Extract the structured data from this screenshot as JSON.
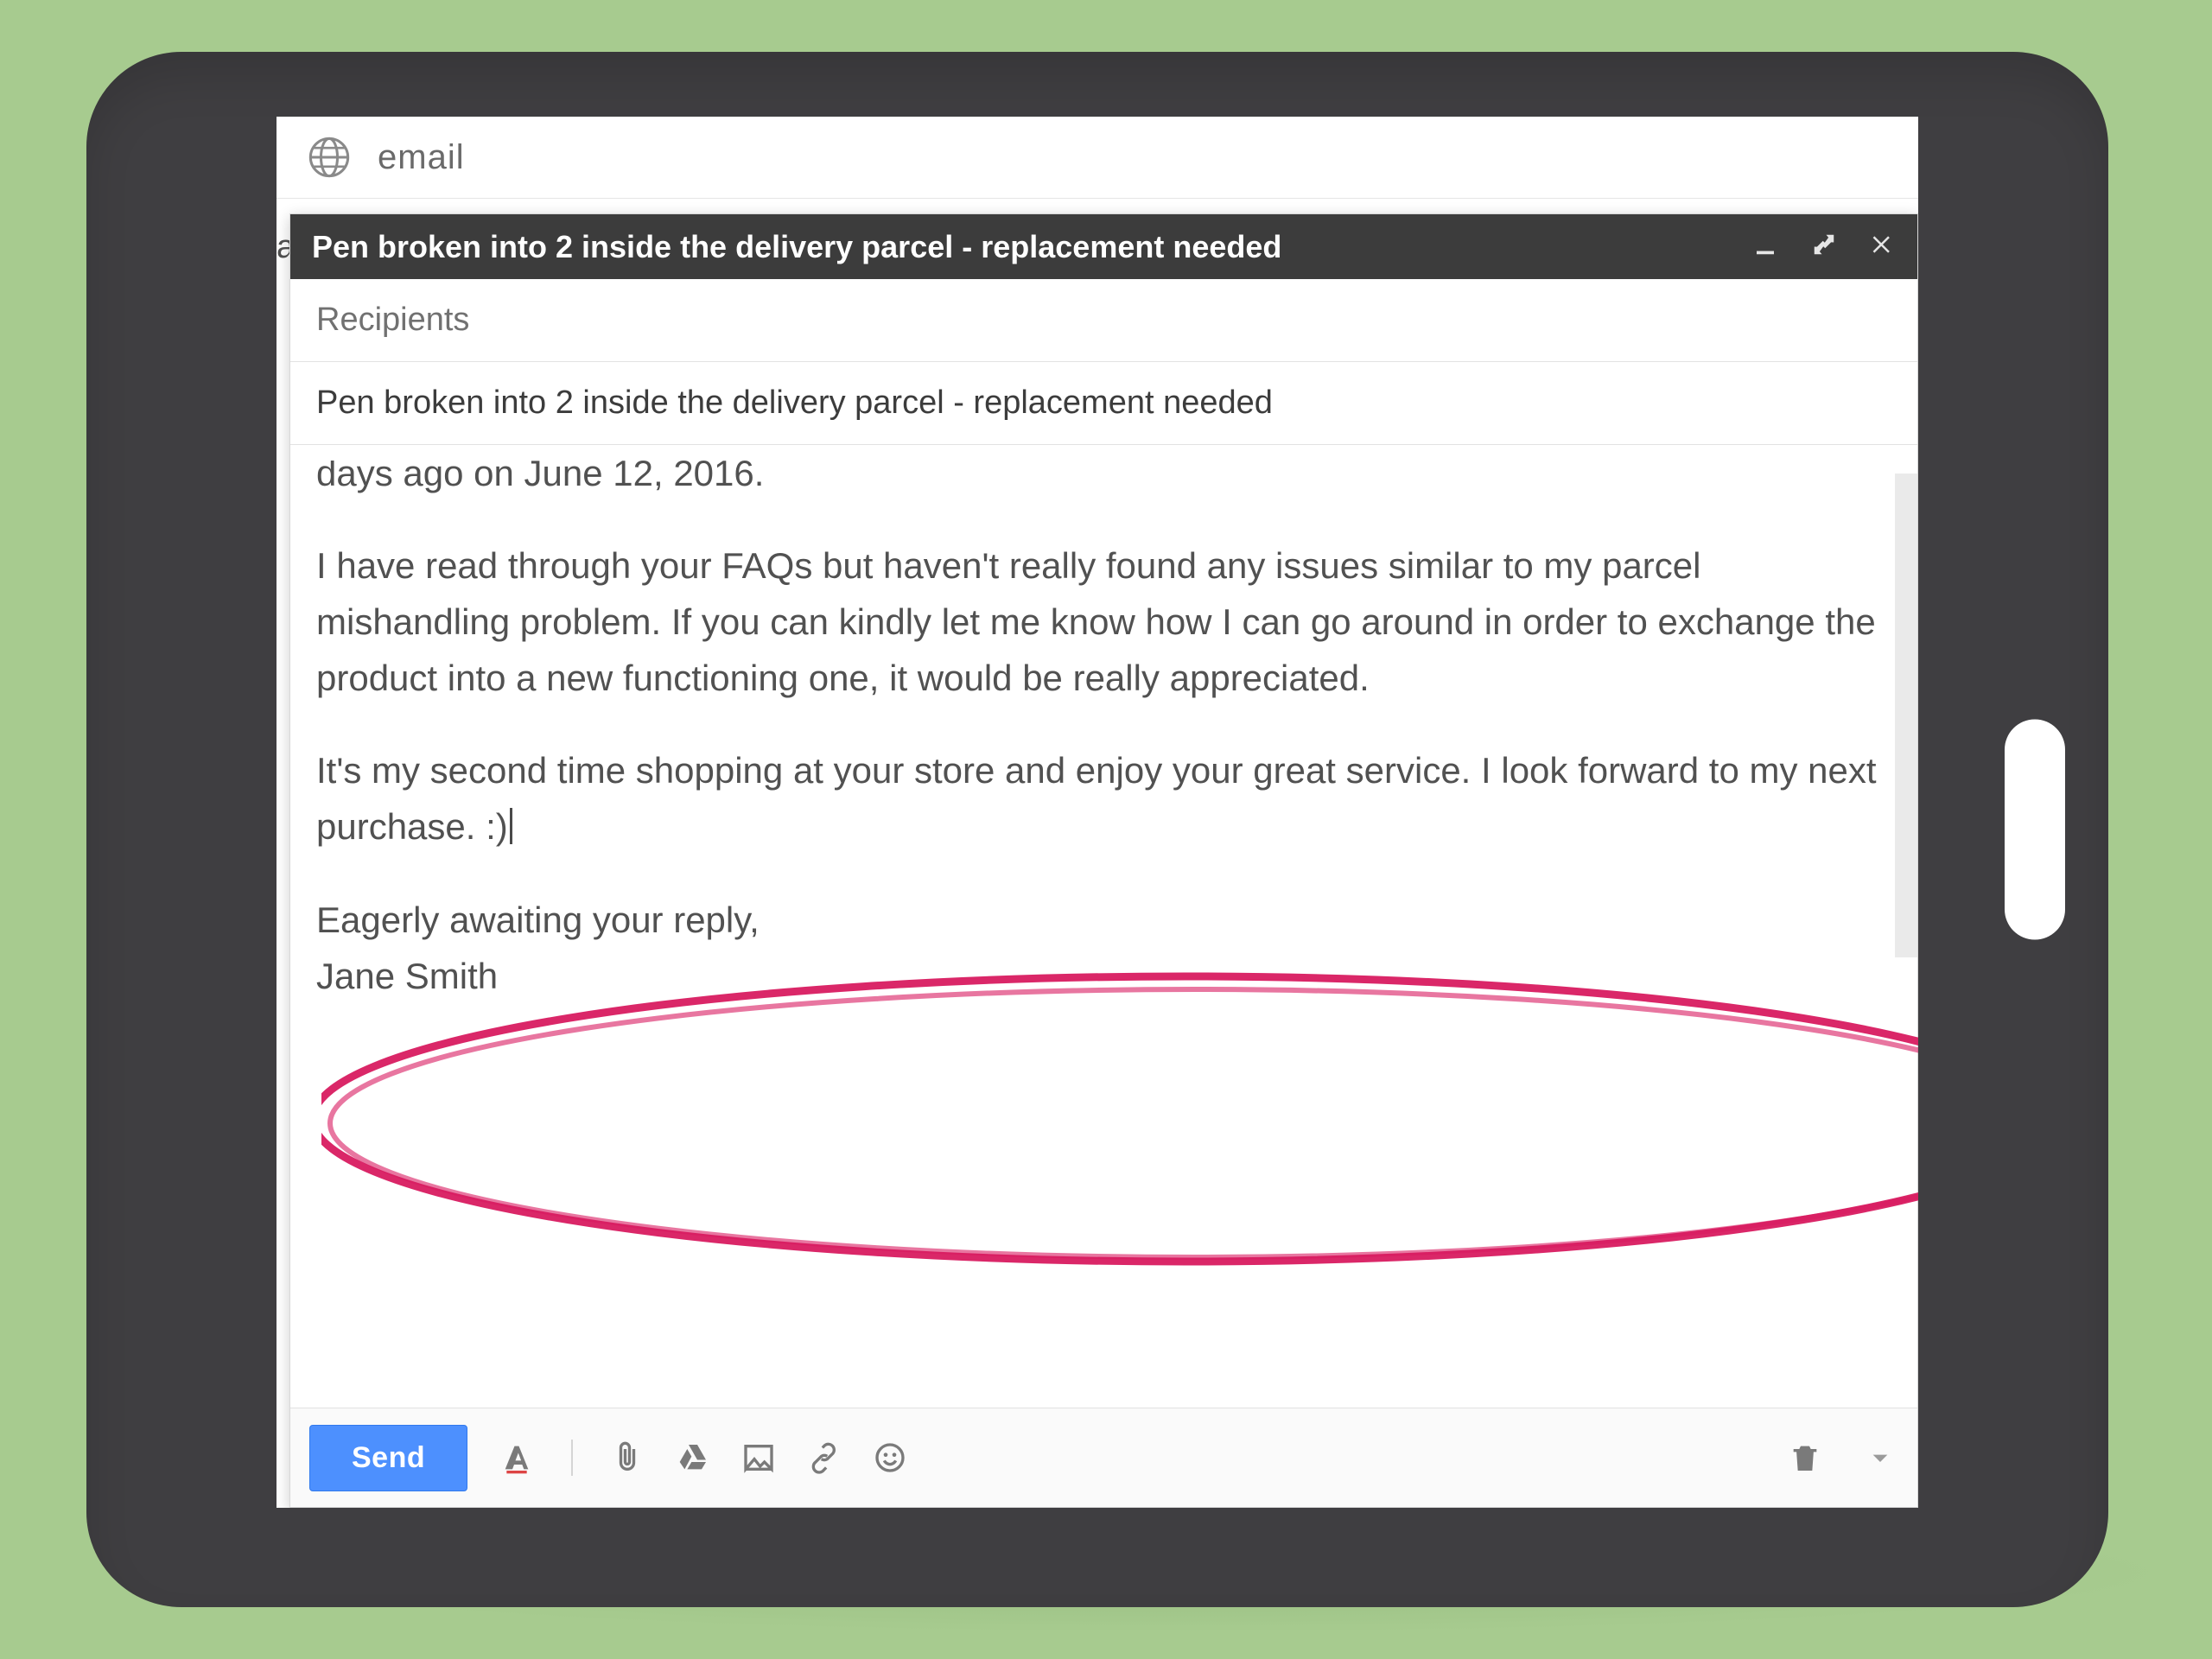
{
  "app": {
    "label": "email"
  },
  "compose": {
    "subject_header": "Pen broken into 2 inside the delivery parcel - replacement needed",
    "recipients_placeholder": "Recipients",
    "subject_value": "Pen broken into 2 inside the delivery parcel - replacement needed",
    "body": {
      "p1": "days ago on June 12, 2016.",
      "p2": "I have read through your FAQs but haven't really found any issues similar to my parcel mishandling problem. If you can kindly let me know how I can go around in order to exchange the product into a new functioning one, it would be really appreciated.",
      "p3": "It's my second time shopping at your store and enjoy your great service. I look forward to my next purchase. :)",
      "closing": "Eagerly awaiting your reply,",
      "signature": "Jane Smith"
    },
    "send_label": "Send"
  },
  "icons": {
    "globe": "globe-icon",
    "minimize": "minimize-icon",
    "expand": "expand-icon",
    "close": "close-icon",
    "format": "format-text-icon",
    "attach": "paperclip-icon",
    "drive": "drive-icon",
    "image": "image-icon",
    "link": "link-icon",
    "emoji": "emoji-icon",
    "trash": "trash-icon",
    "more": "caret-down-icon"
  },
  "annotation": {
    "color": "#d81b60"
  },
  "peek_letter": "a"
}
